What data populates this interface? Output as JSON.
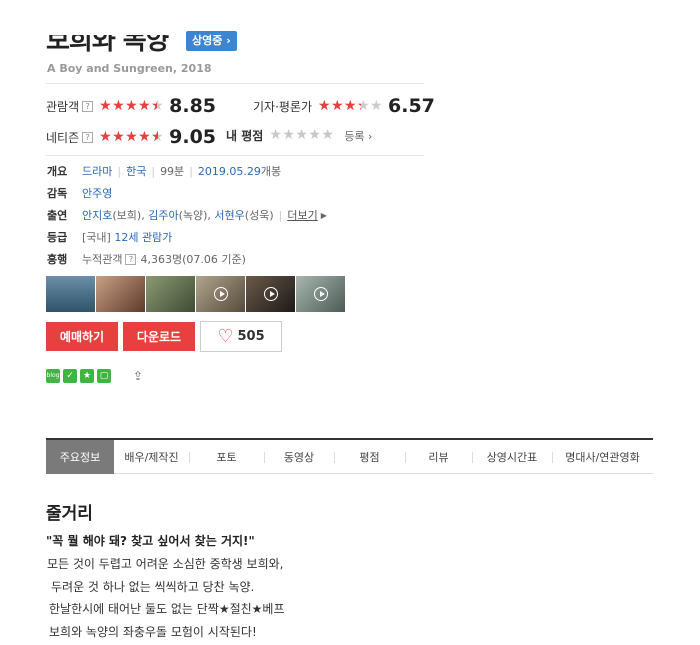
{
  "movie": {
    "title": "보희와 녹양",
    "status_badge": "상영중",
    "subtitle": "A Boy and Sungreen, 2018"
  },
  "ratings": {
    "audience": {
      "label": "관람객",
      "score": "8.85",
      "stars_fraction": 0.885
    },
    "critics": {
      "label": "기자·평론가",
      "score": "6.57",
      "stars_fraction": 0.657
    },
    "netizen": {
      "label": "네티즌",
      "score": "9.05",
      "stars_fraction": 0.905
    },
    "my_rating": {
      "label": "내 평점",
      "link": "등록 ›"
    }
  },
  "info": {
    "overview": {
      "key": "개요",
      "genre": "드라마",
      "country": "한국",
      "runtime": "99분",
      "release_date": "2019.05.29",
      "release_suffix": "개봉"
    },
    "director": {
      "key": "감독",
      "name": "안주영"
    },
    "cast": {
      "key": "출연",
      "actors": [
        "안지호",
        "김주아",
        "서현우"
      ],
      "roles": [
        "(보희)",
        "(녹양)",
        "(성욱)"
      ],
      "more": "더보기"
    },
    "rating": {
      "key": "등급",
      "prefix": "[국내]",
      "value": "12세 관람가"
    },
    "boxoffice": {
      "key": "흥행",
      "label": "누적관객",
      "value": "4,363명",
      "note": "(07.06 기준)"
    }
  },
  "buttons": {
    "reserve": "예매하기",
    "download": "다운로드",
    "like_count": "505"
  },
  "tabs": [
    "주요정보",
    "배우/제작진",
    "포토",
    "동영상",
    "평점",
    "리뷰",
    "상영시간표",
    "명대사/연관영화"
  ],
  "story": {
    "heading": "줄거리",
    "tagline": "\"꼭 뭘 해야 돼? 찾고 싶어서 찾는 거지!\"",
    "lines": [
      "모든 것이 두렵고 어려운 소심한 중학생 보희와,",
      "두려운 것 하나 없는 씩씩하고 당찬 녹양.",
      "한날한시에 태어난 둘도 없는 단짝★절친★베프",
      "보희와 녹양의 좌충우돌 모험이 시작된다!"
    ]
  },
  "colors": {
    "accent_red": "#e8403f",
    "accent_blue": "#3a86d1",
    "link_blue": "#2a67b5",
    "sns_green": "#41b442"
  },
  "icons": [
    "help-icon",
    "star-icon",
    "heart-icon",
    "play-icon",
    "share-icon",
    "sns-icon"
  ]
}
